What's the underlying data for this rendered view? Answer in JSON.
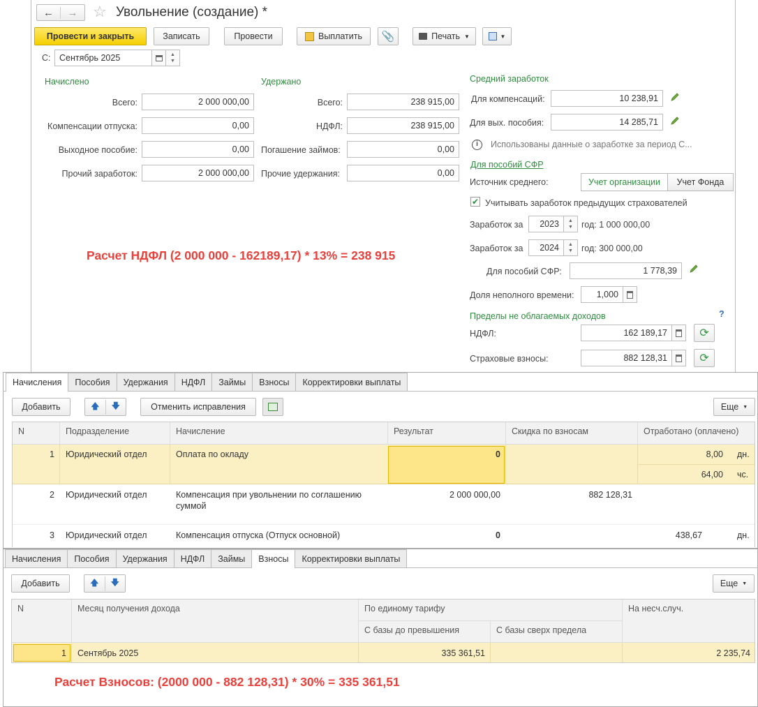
{
  "window": {
    "title": "Увольнение (создание) *"
  },
  "toolbar": {
    "post_close": "Провести и закрыть",
    "save": "Записать",
    "post": "Провести",
    "pay": "Выплатить",
    "print": "Печать"
  },
  "period": {
    "label": "С:",
    "value": "Сентябрь 2025"
  },
  "accrued": {
    "header": "Начислено",
    "total_label": "Всего:",
    "total": "2 000 000,00",
    "vacation_label": "Компенсации отпуска:",
    "vacation": "0,00",
    "severance_label": "Выходное пособие:",
    "severance": "0,00",
    "other_label": "Прочий заработок:",
    "other": "2 000 000,00"
  },
  "withheld": {
    "header": "Удержано",
    "total_label": "Всего:",
    "total": "238 915,00",
    "ndfl_label": "НДФЛ:",
    "ndfl": "238 915,00",
    "loans_label": "Погашение займов:",
    "loans": "0,00",
    "other_label": "Прочие удержания:",
    "other": "0,00"
  },
  "average": {
    "header": "Средний заработок",
    "comp_label": "Для компенсаций:",
    "comp": "10 238,91",
    "sev_label": "Для вых. пособия:",
    "sev": "14 285,71",
    "info": "Использованы данные о заработке за период С...",
    "sfr_link": "Для пособий СФР",
    "source_label": "Источник среднего:",
    "source_org": "Учет организации",
    "source_fund": "Учет Фонда",
    "prev_checkbox": "Учитывать заработок предыдущих страхователей",
    "earn_label": "Заработок за",
    "year1": "2023",
    "year1_text": "год: 1 000 000,00",
    "year2": "2024",
    "year2_text": "год: 300 000,00",
    "sfr_label": "Для пособий СФР:",
    "sfr": "1 778,39",
    "parttime_label": "Доля неполного времени:",
    "parttime": "1,000"
  },
  "limits": {
    "header": "Пределы не облагаемых доходов",
    "help": "?",
    "ndfl_label": "НДФЛ:",
    "ndfl": "162 189,17",
    "ins_label": "Страховые взносы:",
    "ins": "882 128,31"
  },
  "annotations": {
    "ndfl_calc": "Расчет НДФЛ (2 000 000 - 162189,17) * 13% = 238 915",
    "ins_calc": "Расчет Взносов: (2000 000 - 882 128,31) * 30%  = 335 361,51"
  },
  "tabs": [
    "Начисления",
    "Пособия",
    "Удержания",
    "НДФЛ",
    "Займы",
    "Взносы",
    "Корректировки выплаты"
  ],
  "panel1": {
    "add": "Добавить",
    "cancel_fix": "Отменить исправления",
    "more": "Еще",
    "columns": [
      "N",
      "Подразделение",
      "Начисление",
      "Результат",
      "Скидка по взносам",
      "Отработано (оплачено)"
    ],
    "rows": [
      {
        "n": "1",
        "dept": "Юридический отдел",
        "accrual": "Оплата по окладу",
        "result": "0",
        "discount": "",
        "worked1": "8,00",
        "unit1": "дн.",
        "worked2": "64,00",
        "unit2": "чс."
      },
      {
        "n": "2",
        "dept": "Юридический отдел",
        "accrual": "Компенсация при увольнении по соглашению",
        "accrual2": "суммой",
        "result": "2 000 000,00",
        "discount": "882 128,31"
      },
      {
        "n": "3",
        "dept": "Юридический отдел",
        "accrual": "Компенсация отпуска (Отпуск основной)",
        "result": "0",
        "discount": "",
        "worked1": "438,67",
        "unit1": "дн."
      }
    ]
  },
  "panel2": {
    "add": "Добавить",
    "more": "Еще",
    "columns": {
      "n": "N",
      "month": "Месяц получения дохода",
      "tariff": "По единому тарифу",
      "base_under": "С базы до превышения",
      "base_over": "С базы сверх предела",
      "accident": "На несч.случ."
    },
    "rows": [
      {
        "n": "1",
        "month": "Сентябрь 2025",
        "base_under": "335 361,51",
        "base_over": "",
        "accident": "2 235,74"
      }
    ]
  }
}
